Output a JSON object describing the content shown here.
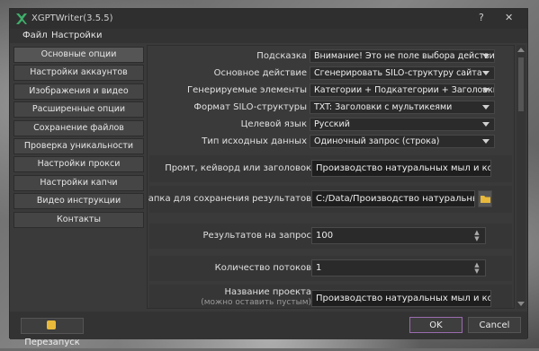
{
  "window": {
    "title": "XGPTWriter(3.5.5)",
    "help_btn": "?",
    "close_btn": "✕"
  },
  "menu": {
    "file": "Файл",
    "settings": "Настройки"
  },
  "sidebar": {
    "items": [
      {
        "label": "Основные опции"
      },
      {
        "label": "Настройки аккаунтов"
      },
      {
        "label": "Изображения и видео"
      },
      {
        "label": "Расширенные опции"
      },
      {
        "label": "Сохранение файлов"
      },
      {
        "label": "Проверка уникальности"
      },
      {
        "label": "Настройки прокси"
      },
      {
        "label": "Настройки капчи"
      },
      {
        "label": "Видео инструкции"
      },
      {
        "label": "Контакты"
      }
    ]
  },
  "options": [
    {
      "label": "Подсказка",
      "value": "Внимание! Это не поле выбора действия, а"
    },
    {
      "label": "Основное действие",
      "value": "Сгенерировать SILO-структуру сайта"
    },
    {
      "label": "Генерируемые элементы",
      "value": "Категории + Подкатегории + Заголовки стате"
    },
    {
      "label": "Формат SILO-структуры",
      "value": "TXT: Заголовки с мультикеями"
    },
    {
      "label": "Целевой язык",
      "value": "Русский"
    },
    {
      "label": "Тип исходных данных",
      "value": "Одиночный запрос (строка)"
    }
  ],
  "prompt": {
    "label": "Промт, кейворд или заголовок",
    "value": "Производство натуральных мыл и косметики"
  },
  "folder": {
    "label": "Папка для сохранения результатов",
    "value": "C:/Data/Производство натуральных мыл"
  },
  "results": {
    "label": "Результатов на запрос",
    "value": "100"
  },
  "threads": {
    "label": "Количество потоков",
    "value": "1"
  },
  "project": {
    "label": "Название проекта",
    "sublabel": "(можно оставить пустым)",
    "value": "Производство натуральных мыл и косметики"
  },
  "buttons": {
    "restart": "Перезапуск",
    "ok": "OK",
    "cancel": "Cancel"
  },
  "colors": {
    "accent_ok": "#9a6bb0",
    "logo": "#3fae6a",
    "folder_icon": "#e8b93a"
  }
}
